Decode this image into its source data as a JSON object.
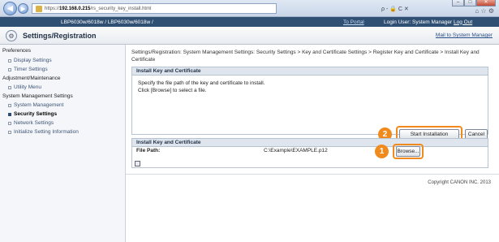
{
  "browser": {
    "url_prefix": "https://",
    "url_host": "192.168.0.215",
    "url_path": "/rs_security_key_install.html",
    "search_text": "ρ - 🔒 C ✕",
    "tab_icons": "⌂ ☆ ⚙"
  },
  "topbar": {
    "device_model": "LBP6030w/6018w / LBP6030w/6018w /",
    "portal_link": "To Portal",
    "login_user": "Login User: System Manager",
    "logout": "Log Out"
  },
  "titlebar": {
    "title": "Settings/Registration",
    "mailto": "Mail to System Manager"
  },
  "sidebar": {
    "groups": [
      {
        "label": "Preferences"
      },
      {
        "label": "Adjustment/Maintenance"
      },
      {
        "label": "System Management Settings"
      }
    ],
    "items": [
      {
        "label": "Display Settings"
      },
      {
        "label": "Timer Settings"
      },
      {
        "label": "Utility Menu"
      },
      {
        "label": "System Management"
      },
      {
        "label": "Security Settings"
      },
      {
        "label": "Network Settings"
      },
      {
        "label": "Initialize Setting Information"
      }
    ]
  },
  "main": {
    "breadcrumb": "Settings/Registration: System Management Settings: Security Settings > Key and Certificate Settings > Register Key and Certificate > Install Key and Certificate",
    "section_title": "Install Key and Certificate",
    "instructions_line1": "Specify the file path of the key and certificate to install.",
    "instructions_line2": "Click [Browse] to select a file.",
    "start_button": "Start Installation",
    "cancel_button": "Cancel",
    "subsection_title": "Install Key and Certificate",
    "file_path_label": "File Path:",
    "file_path_value": "C:\\Example\\EXAMPLE.p12",
    "browse_button": "Browse...",
    "copyright": "Copyright CANON INC. 2013"
  },
  "callouts": [
    "2",
    "1"
  ],
  "colors": {
    "topbar": "#2f4f73",
    "highlight": "#f08a1c",
    "panel_header": "#dfe5ed"
  }
}
